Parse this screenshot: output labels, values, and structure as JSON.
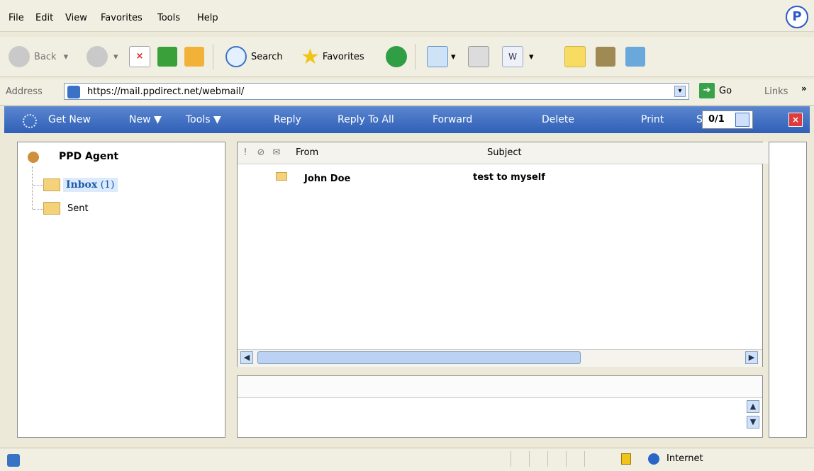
{
  "menubar": {
    "items": [
      "File",
      "Edit",
      "View",
      "Favorites",
      "Tools",
      "Help"
    ]
  },
  "toolbar": {
    "back": "Back",
    "search": "Search",
    "favorites": "Favorites"
  },
  "address": {
    "label": "Address",
    "url": "https://mail.ppdirect.net/webmail/",
    "go": "Go",
    "links": "Links"
  },
  "app": {
    "get_new": "Get New",
    "new": "New",
    "tools": "Tools",
    "reply": "Reply",
    "reply_all": "Reply To All",
    "forward": "Forward",
    "delete": "Delete",
    "print": "Print",
    "s": "S",
    "counter": "0/1"
  },
  "folders": {
    "account": "PPD Agent",
    "items": [
      {
        "label": "Inbox",
        "count": "(1)",
        "selected": true
      },
      {
        "label": "Sent",
        "count": ""
      }
    ]
  },
  "messages": {
    "headers": [
      "From",
      "Subject"
    ],
    "rows": [
      {
        "from": "John Doe",
        "subject": "test to myself"
      }
    ]
  },
  "status": {
    "zone": "Internet"
  },
  "colors": {
    "accent": "#2f5fb7",
    "selected_bg": "#dbeafc"
  }
}
